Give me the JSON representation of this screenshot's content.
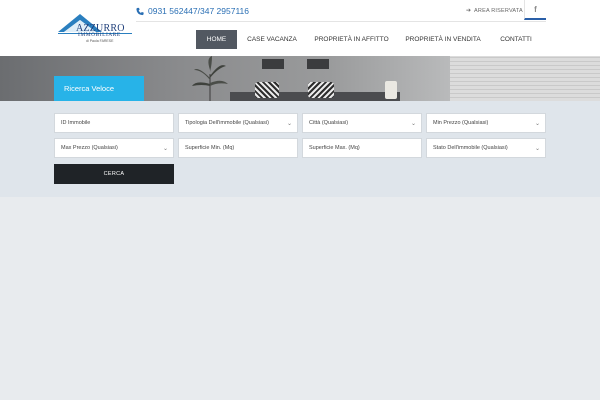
{
  "header": {
    "logo": {
      "brand": "AZZURRO",
      "sub": "IMMOBILIARE",
      "tagline": "di Paola FARESE"
    },
    "phone": "0931 562447/347 2957116",
    "area_riservata": "AREA RISERVATA",
    "facebook": "f"
  },
  "nav": {
    "items": [
      "HOME",
      "CASE VACANZA",
      "PROPRIETÀ IN AFFITTO",
      "PROPRIETÀ IN VENDITA",
      "CONTATTI"
    ],
    "active": "HOME"
  },
  "search": {
    "tab_label": "Ricerca Veloce",
    "fields": {
      "id_immobile": "ID Immobile",
      "tipologia": "Tipologia Dell'immobile (Qualsiasi)",
      "citta": "Città (Qualsiasi)",
      "min_prezzo": "Min Prezzo (Qualsiasi)",
      "max_prezzo": "Max Prezzo (Qualsiasi)",
      "superficie_min": "Superficie Min. (Mq)",
      "superficie_max": "Superficie Max. (Mq)",
      "stato": "Stato Dell'immobile (Qualsiasi)"
    },
    "button": "CERCA"
  },
  "colors": {
    "accent_blue": "#27b3e8",
    "nav_active": "#525861",
    "button_dark": "#1f2327",
    "panel_bg": "#dfe5eb",
    "page_bg": "#e8ebee"
  }
}
